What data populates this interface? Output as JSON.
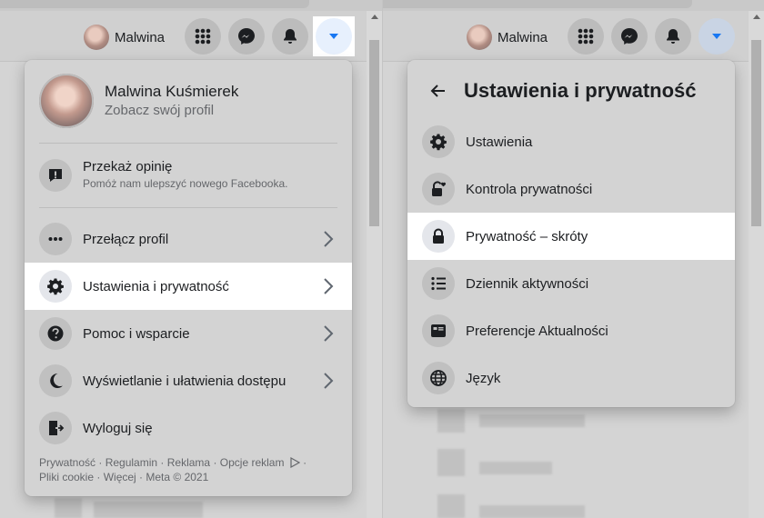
{
  "user": {
    "short_name": "Malwina",
    "full_name": "Malwina Kuśmierek",
    "profile_link": "Zobacz swój profil"
  },
  "left_menu": {
    "feedback": {
      "title": "Przekaż opinię",
      "subtitle": "Pomóż nam ulepszyć nowego Facebooka."
    },
    "items": [
      {
        "label": "Przełącz profil",
        "icon": "dots-icon",
        "has_chevron": true
      },
      {
        "label": "Ustawienia i prywatność",
        "icon": "gear-icon",
        "has_chevron": true,
        "highlighted": true
      },
      {
        "label": "Pomoc i wsparcie",
        "icon": "question-icon",
        "has_chevron": true
      },
      {
        "label": "Wyświetlanie i ułatwienia dostępu",
        "icon": "moon-icon",
        "has_chevron": true
      },
      {
        "label": "Wyloguj się",
        "icon": "logout-icon",
        "has_chevron": false
      }
    ],
    "footer": {
      "links": [
        "Prywatność",
        "Regulamin",
        "Reklama",
        "Opcje reklam"
      ],
      "links2": [
        "Pliki cookie",
        "Więcej"
      ],
      "copyright": "Meta © 2021",
      "separator": " · "
    }
  },
  "right_menu": {
    "title": "Ustawienia i prywatność",
    "items": [
      {
        "label": "Ustawienia",
        "icon": "gear-icon"
      },
      {
        "label": "Kontrola prywatności",
        "icon": "lock-heart-icon"
      },
      {
        "label": "Prywatność – skróty",
        "icon": "lock-icon",
        "highlighted": true
      },
      {
        "label": "Dziennik aktywności",
        "icon": "list-icon"
      },
      {
        "label": "Preferencje Aktualności",
        "icon": "feed-icon"
      },
      {
        "label": "Język",
        "icon": "globe-icon"
      }
    ]
  },
  "colors": {
    "accent": "#1877f2",
    "highlight_bg": "#ffffff",
    "overlay_bg": "#d3d3d3"
  }
}
